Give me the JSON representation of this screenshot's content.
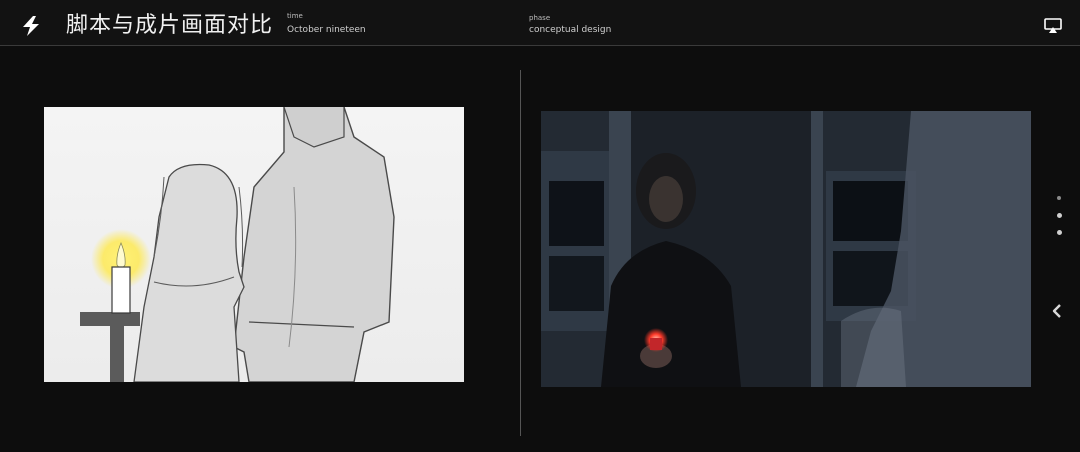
{
  "header": {
    "title": "脚本与成片画面对比",
    "time_label": "time",
    "time_value": "October nineteen",
    "phase_label": "phase",
    "phase_value": "conceptual design"
  },
  "icons": {
    "logo": "lightning-bolt-icon",
    "screen": "screen-cast-icon",
    "nav_prev": "chevron-left-icon"
  },
  "images": {
    "left": "storyboard-sketch",
    "right": "film-still"
  },
  "pager": {
    "count": 3,
    "active_index": 1
  },
  "colors": {
    "background": "#0d0d0d",
    "header": "#121212",
    "text": "#e8e8e8",
    "candle_glow": "#ffe94a",
    "candle_flame": "#ff3a2a"
  }
}
